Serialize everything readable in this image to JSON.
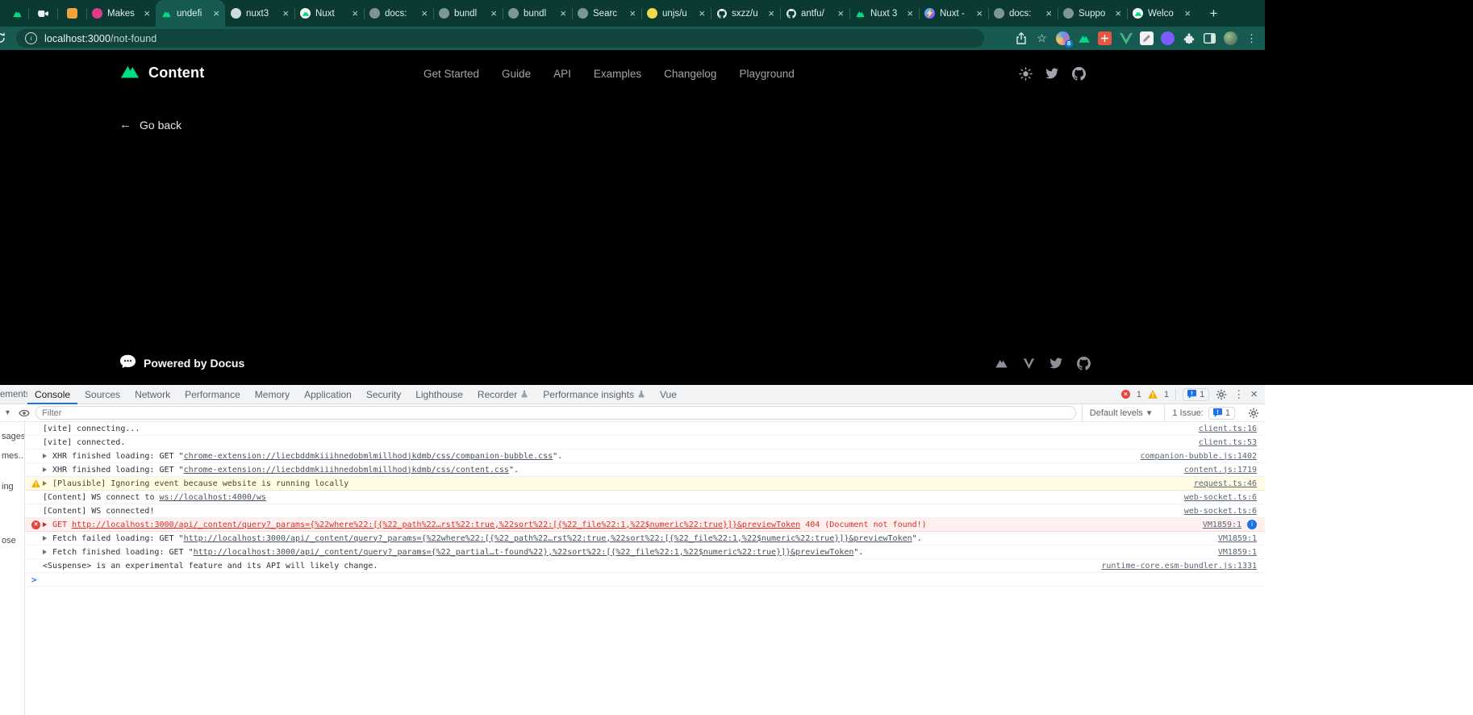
{
  "browser": {
    "close_glyph": "×",
    "new_tab_glyph": "+",
    "kebab_glyph": "⋮",
    "star_glyph": "☆",
    "info_glyph": "i",
    "extension_badge": "8",
    "address": {
      "host": "localhost:3000",
      "path": "/not-found"
    },
    "tabs": [
      {
        "icon": "nuxt",
        "kind": "partial",
        "label": ""
      },
      {
        "icon": "camera",
        "kind": "mini",
        "label": ""
      },
      {
        "icon": "note",
        "kind": "mini",
        "label": ""
      },
      {
        "icon": "pink",
        "label": "Makes"
      },
      {
        "icon": "nuxt",
        "label": "undefi",
        "active": true
      },
      {
        "icon": "pale",
        "label": "nuxt3"
      },
      {
        "icon": "nuxtwhite",
        "label": "Nuxt"
      },
      {
        "icon": "gray",
        "label": "docs:"
      },
      {
        "icon": "gray",
        "label": "bundl"
      },
      {
        "icon": "gray",
        "label": "bundl"
      },
      {
        "icon": "gray",
        "label": "Searc"
      },
      {
        "icon": "unjs",
        "label": "unjs/u"
      },
      {
        "icon": "github",
        "label": "sxzz/u"
      },
      {
        "icon": "github",
        "label": "antfu/"
      },
      {
        "icon": "nuxt",
        "label": "Nuxt 3"
      },
      {
        "icon": "vite",
        "label": "Nuxt -"
      },
      {
        "icon": "gray",
        "label": "docs:"
      },
      {
        "icon": "gray",
        "label": "Suppo"
      },
      {
        "icon": "nuxtwhite",
        "label": "Welco"
      }
    ],
    "toolbar_icons": [
      "share-icon",
      "bookmark-star-icon",
      "profile-sync-icon",
      "nuxt-extension-icon",
      "grid-extension-icon",
      "vue-devtools-icon",
      "notes-extension-icon",
      "violet-extension-icon",
      "puzzle-extensions-icon",
      "side-panel-icon",
      "profile-avatar-icon",
      "kebab-menu-icon"
    ]
  },
  "page": {
    "brand": "Content",
    "nav": [
      "Get Started",
      "Guide",
      "API",
      "Examples",
      "Changelog",
      "Playground"
    ],
    "header_icons": [
      "color-mode-icon",
      "twitter-icon",
      "github-icon"
    ],
    "back_arrow": "←",
    "back_label": "Go back",
    "footer_label": "Powered by Docus",
    "footer_icons": [
      "nuxt-icon",
      "vite-icon",
      "twitter-icon",
      "github-icon"
    ]
  },
  "devtools": {
    "tab_fragment": "ements",
    "caret_glyph": "▾",
    "prompt_glyph": ">",
    "tabs": [
      {
        "label": "Console",
        "active": true
      },
      {
        "label": "Sources"
      },
      {
        "label": "Network"
      },
      {
        "label": "Performance"
      },
      {
        "label": "Memory"
      },
      {
        "label": "Application"
      },
      {
        "label": "Security"
      },
      {
        "label": "Lighthouse"
      },
      {
        "label": "Recorder",
        "exp": true
      },
      {
        "label": "Performance insights",
        "exp": true
      },
      {
        "label": "Vue"
      }
    ],
    "badges": {
      "errors": "1",
      "warnings": "1",
      "issues": "1"
    },
    "filter_placeholder": "Filter",
    "levels_label": "Default levels",
    "issues_label": "1 Issue:",
    "issues_count": "1",
    "sidebar_fragments": [
      "sages",
      "mes...",
      "ing",
      "ose"
    ],
    "messages": [
      {
        "source": "client.ts:16",
        "parts": [
          {
            "k": "t",
            "v": "[vite] connecting..."
          }
        ]
      },
      {
        "source": "client.ts:53",
        "parts": [
          {
            "k": "t",
            "v": "[vite] connected."
          }
        ]
      },
      {
        "source": "companion-bubble.js:1402",
        "expand": true,
        "parts": [
          {
            "k": "t",
            "v": "XHR finished loading: GET \""
          },
          {
            "k": "l",
            "v": "chrome-extension://liecbddmkiiihnedobmlmillhodjkdmb/css/companion-bubble.css"
          },
          {
            "k": "t",
            "v": "\"."
          }
        ]
      },
      {
        "source": "content.js:1719",
        "expand": true,
        "parts": [
          {
            "k": "t",
            "v": "XHR finished loading: GET \""
          },
          {
            "k": "l",
            "v": "chrome-extension://liecbddmkiiihnedobmlmillhodjkdmb/css/content.css"
          },
          {
            "k": "t",
            "v": "\"."
          }
        ]
      },
      {
        "source": "request.ts:46",
        "level": "warning",
        "expand": true,
        "parts": [
          {
            "k": "t",
            "v": "[Plausible] Ignoring event because website is running locally"
          }
        ]
      },
      {
        "source": "web-socket.ts:6",
        "parts": [
          {
            "k": "t",
            "v": "[Content] WS connect to "
          },
          {
            "k": "l",
            "v": "ws://localhost:4000/ws"
          }
        ]
      },
      {
        "source": "web-socket.ts:6",
        "parts": [
          {
            "k": "t",
            "v": "[Content] WS connected!"
          }
        ]
      },
      {
        "source": "VM1859:1",
        "level": "error",
        "expand": true,
        "issue_icon": true,
        "parts": [
          {
            "k": "t",
            "v": "GET "
          },
          {
            "k": "l",
            "v": "http://localhost:3000/api/_content/query?_params={%22where%22:[{%22_path%22…rst%22:true,%22sort%22:[{%22_file%22:1,%22$numeric%22:true}]}&previewToken"
          },
          {
            "k": "t",
            "v": " 404 (Document not found!)"
          }
        ]
      },
      {
        "source": "VM1859:1",
        "expand": true,
        "parts": [
          {
            "k": "t",
            "v": "Fetch failed loading: GET \""
          },
          {
            "k": "l",
            "v": "http://localhost:3000/api/_content/query?_params={%22where%22:[{%22_path%22…rst%22:true,%22sort%22:[{%22_file%22:1,%22$numeric%22:true}]}&previewToken"
          },
          {
            "k": "t",
            "v": "\"."
          }
        ]
      },
      {
        "source": "VM1859:1",
        "expand": true,
        "parts": [
          {
            "k": "t",
            "v": "Fetch finished loading: GET \""
          },
          {
            "k": "l",
            "v": "http://localhost:3000/api/_content/query?_params={%22_partial…t-found%22},%22sort%22:[{%22_file%22:1,%22$numeric%22:true}]}&previewToken"
          },
          {
            "k": "t",
            "v": "\"."
          }
        ]
      },
      {
        "source": "runtime-core.esm-bundler.js:1331",
        "parts": [
          {
            "k": "t",
            "v": "<Suspense> is an experimental feature and its API will likely change."
          }
        ]
      }
    ]
  }
}
